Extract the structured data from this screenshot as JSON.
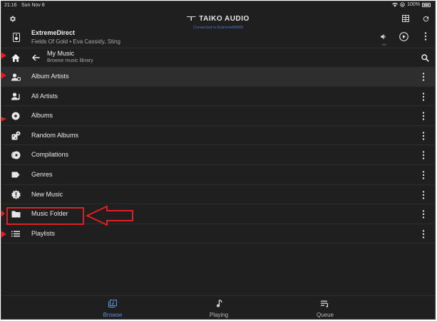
{
  "status_bar": {
    "time": "21:16",
    "date": "Sun Nov 8",
    "battery": "100%"
  },
  "header": {
    "brand": "TAIKO AUDIO",
    "connection": "Connected to Extreme99999"
  },
  "now_playing": {
    "title": "ExtremeDirect",
    "subtitle": "Fields Of Gold • Eva Cassidy, Sting",
    "volume_label": "0%"
  },
  "nav": {
    "title": "My Music",
    "subtitle": "Browse music library"
  },
  "list": {
    "items": [
      {
        "label": "Album Artists",
        "icon": "album-artist-icon"
      },
      {
        "label": "All Artists",
        "icon": "artist-icon"
      },
      {
        "label": "Albums",
        "icon": "disc-icon"
      },
      {
        "label": "Random Albums",
        "icon": "dice-icon"
      },
      {
        "label": "Compilations",
        "icon": "compilation-icon"
      },
      {
        "label": "Genres",
        "icon": "tag-icon"
      },
      {
        "label": "New Music",
        "icon": "new-badge-icon"
      },
      {
        "label": "Music Folder",
        "icon": "folder-icon"
      },
      {
        "label": "Playlists",
        "icon": "playlist-icon"
      }
    ]
  },
  "tabs": [
    {
      "label": "Browse",
      "icon": "browse-icon"
    },
    {
      "label": "Playing",
      "icon": "music-note-icon"
    },
    {
      "label": "Queue",
      "icon": "queue-icon"
    }
  ],
  "colors": {
    "background": "#1f1f1f",
    "accent": "#5a8fe0",
    "annotation": "#e02020"
  }
}
